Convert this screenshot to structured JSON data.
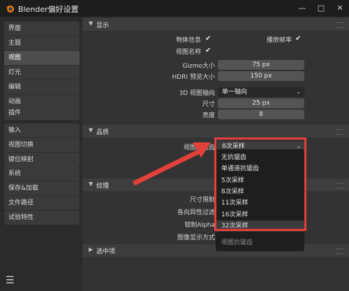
{
  "window": {
    "title": "Blender偏好设置",
    "minimize": "—",
    "maximize": "□",
    "close": "✕"
  },
  "sidebar": {
    "groups": [
      [
        "界面",
        "主题",
        "视图",
        "灯光",
        "编辑",
        "动画"
      ],
      [
        "插件"
      ],
      [
        "输入",
        "视图切换",
        "键位映射"
      ],
      [
        "系统",
        "保存&加载",
        "文件路径"
      ],
      [
        "试验特性"
      ]
    ],
    "active": "视图"
  },
  "panels": {
    "display": {
      "title": "显示",
      "object_info": "物体信息",
      "view_name": "视图名称",
      "playback_fps": "播放帧率",
      "gizmo_label": "Gizmo大小",
      "gizmo_value": "75 px",
      "hdri_label": "HDRI 预览大小",
      "hdri_value": "150 px",
      "axis_label": "3D 视图轴向",
      "axis_value": "单一轴向",
      "size_label": "尺寸",
      "size_value": "25 px",
      "brightness_label": "亮度",
      "brightness_value": "8"
    },
    "quality": {
      "title": "品质",
      "aa_label": "视图抗锯齿",
      "aa_value": "8次采样"
    },
    "texture": {
      "title": "纹理",
      "size_limit": "尺寸限制",
      "anisotropic": "各向异性过滤",
      "clip_alpha": "钳制Alpha",
      "display_method": "图像显示方式"
    },
    "selection": {
      "title": "选中项"
    }
  },
  "aa_popup": {
    "options": [
      "无抗锯齿",
      "单通道抗锯齿",
      "5次采样",
      "8次采样",
      "11次采样",
      "16次采样",
      "32次采样"
    ],
    "selected": "32次采样",
    "footer": "视图抗锯齿"
  },
  "icons": {
    "checkbox": "✔",
    "chevron": "⌄",
    "expanded": "▼",
    "collapsed": "▶",
    "menu": "☰"
  },
  "colors": {
    "annotation": "#e2403a"
  }
}
